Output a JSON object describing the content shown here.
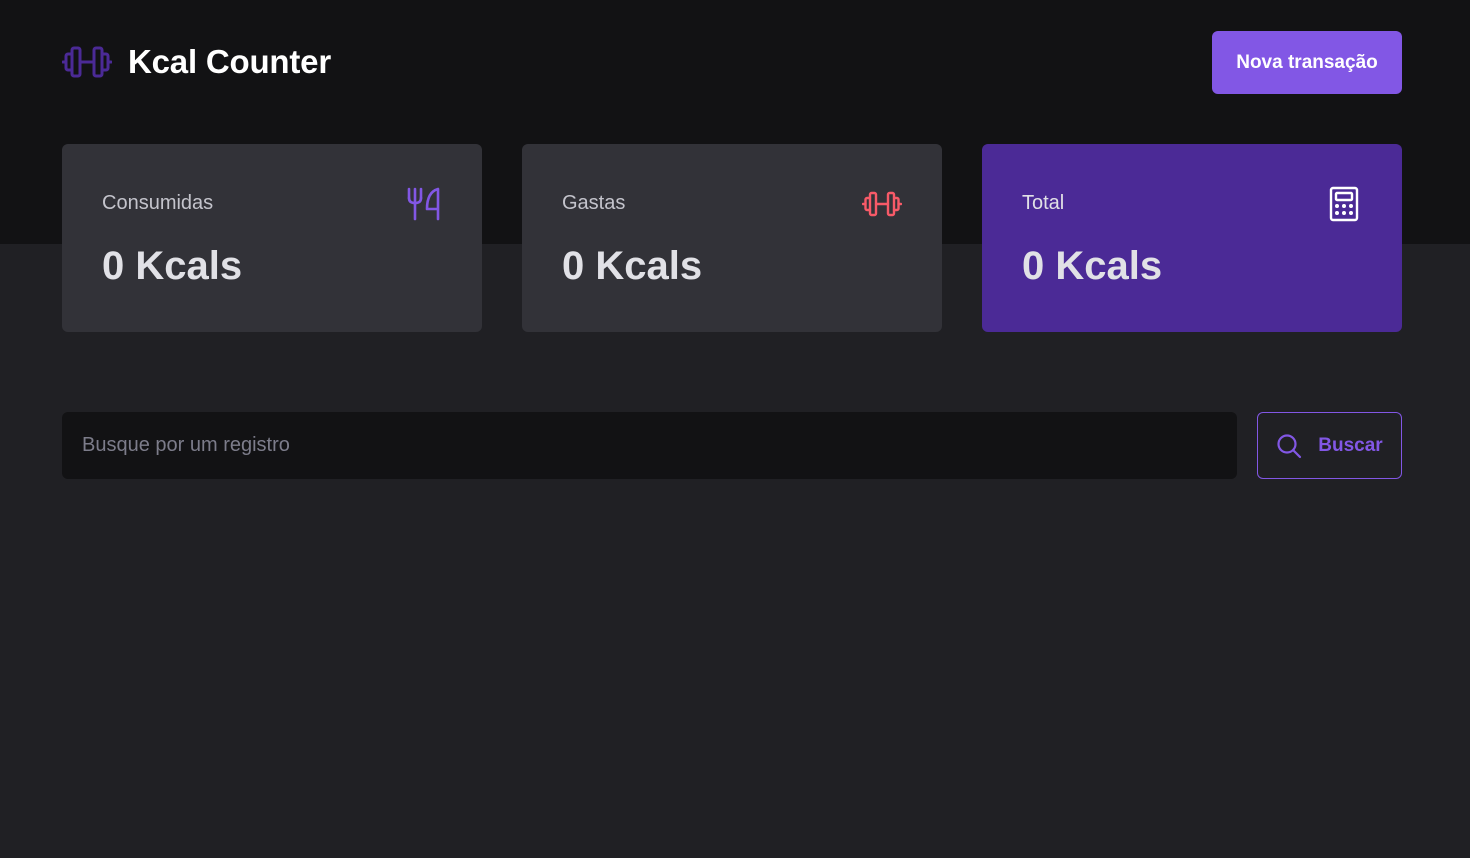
{
  "header": {
    "brand_title": "Kcal Counter",
    "brand_icon": "barbell-icon",
    "new_transaction_label": "Nova transação"
  },
  "summary": {
    "consumed": {
      "label": "Consumidas",
      "value": "0 Kcals",
      "icon": "fork-knife-icon",
      "icon_color": "#8257e5"
    },
    "spent": {
      "label": "Gastas",
      "value": "0 Kcals",
      "icon": "barbell-icon",
      "icon_color": "#f75a68"
    },
    "total": {
      "label": "Total",
      "value": "0 Kcals",
      "icon": "calculator-icon",
      "icon_color": "#ffffff"
    }
  },
  "search": {
    "placeholder": "Busque por um registro",
    "button_label": "Buscar",
    "button_icon": "search-icon"
  },
  "colors": {
    "accent": "#8257e5",
    "total_card": "#4b2a96",
    "danger": "#f75a68",
    "header_bg": "#121214",
    "page_bg": "#202024"
  }
}
